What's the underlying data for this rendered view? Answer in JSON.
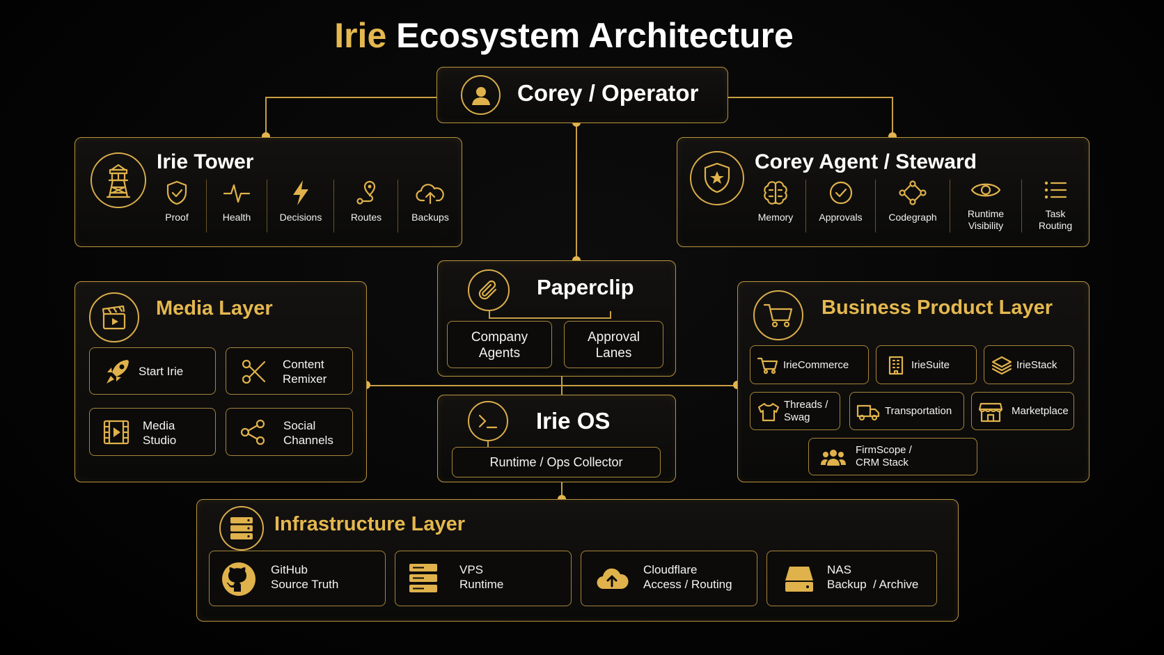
{
  "title": {
    "accent": "Irie",
    "rest": "Ecosystem Architecture"
  },
  "operator": {
    "label": "Corey / Operator"
  },
  "tower": {
    "title": "Irie Tower",
    "features": [
      "Proof",
      "Health",
      "Decisions",
      "Routes",
      "Backups"
    ]
  },
  "agent": {
    "title": "Corey Agent / Steward",
    "features": [
      {
        "line1": "Memory",
        "line2": ""
      },
      {
        "line1": "Approvals",
        "line2": ""
      },
      {
        "line1": "Codegraph",
        "line2": ""
      },
      {
        "line1": "Runtime",
        "line2": "Visibility"
      },
      {
        "line1": "Task",
        "line2": "Routing"
      }
    ]
  },
  "paperclip": {
    "title": "Paperclip",
    "items": [
      {
        "line1": "Company",
        "line2": "Agents"
      },
      {
        "line1": "Approval",
        "line2": "Lanes"
      }
    ]
  },
  "irieos": {
    "title": "Irie OS",
    "item": "Runtime / Ops Collector"
  },
  "media": {
    "title": "Media Layer",
    "items": [
      {
        "line1": "Start Irie",
        "line2": ""
      },
      {
        "line1": "Content",
        "line2": "Remixer"
      },
      {
        "line1": "Media",
        "line2": "Studio"
      },
      {
        "line1": "Social",
        "line2": "Channels"
      }
    ]
  },
  "business": {
    "title": "Business Product Layer",
    "items": [
      {
        "line1": "IrieCommerce",
        "line2": ""
      },
      {
        "line1": "IrieSuite",
        "line2": ""
      },
      {
        "line1": "IrieStack",
        "line2": ""
      },
      {
        "line1": "Threads /",
        "line2": "Swag"
      },
      {
        "line1": "Transportation",
        "line2": ""
      },
      {
        "line1": "Marketplace",
        "line2": ""
      },
      {
        "line1": "FirmScope /",
        "line2": "CRM Stack"
      }
    ]
  },
  "infra": {
    "title": "Infrastructure Layer",
    "items": [
      {
        "line1": "GitHub",
        "line2": "Source Truth"
      },
      {
        "line1": "VPS",
        "line2": "Runtime"
      },
      {
        "line1": "Cloudflare",
        "line2": "Access / Routing"
      },
      {
        "line1": "NAS",
        "line2": "Backup  / Archive"
      }
    ]
  },
  "colors": {
    "accent": "#e5b84f",
    "border": "#b9933e",
    "background": "#050505"
  }
}
